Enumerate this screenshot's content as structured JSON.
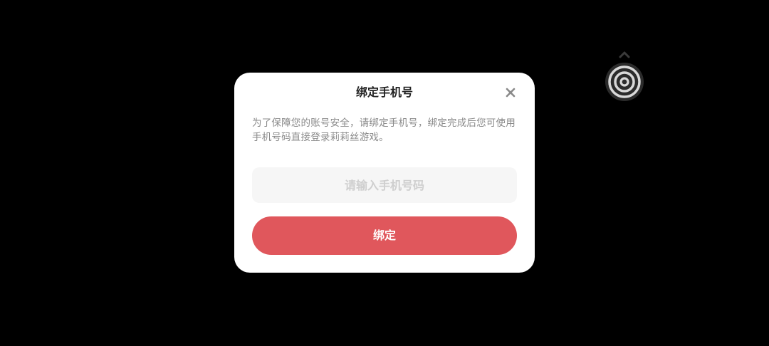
{
  "dialog": {
    "title": "绑定手机号",
    "close_icon": "close-icon",
    "description": "为了保障您的账号安全，请绑定手机号，绑定完成后您可使用手机号码直接登录莉莉丝游戏。",
    "phone_input": {
      "value": "",
      "placeholder": "请输入手机号码"
    },
    "bind_button_label": "绑定"
  },
  "floating_widget": {
    "icon": "target-icon",
    "handle_icon": "chevron-up-icon"
  },
  "colors": {
    "background": "#000000",
    "dialog_bg": "#ffffff",
    "accent": "#e0575c",
    "input_bg": "#f6f6f6",
    "text_primary": "#222222",
    "text_secondary": "#8a8a8a",
    "placeholder": "#cfcfcf"
  }
}
